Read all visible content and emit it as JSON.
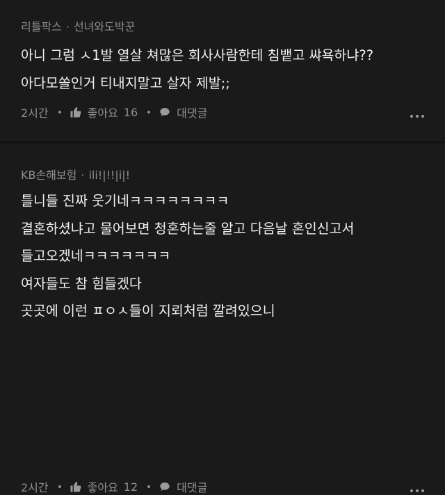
{
  "comments": [
    {
      "author": "리틀팍스",
      "separator": "·",
      "author_tag": "선녀와도박꾼",
      "lines": [
        "아니 그럼 ㅅ1발 열살 쳐많은 회사사람한테 침뱉고 쌰욕하냐??",
        "아다모쏠인거 티내지말고 살자 제발;;"
      ],
      "time": "2시간",
      "like_icon": "thumbs-up-icon",
      "like_label": "좋아요",
      "like_count": "16",
      "reply_icon": "speech-bubble-icon",
      "reply_label": "대댓글",
      "more_icon": "more-dots-icon"
    },
    {
      "author": "KB손해보험",
      "separator": "·",
      "author_tag": "ili!|!!|i|!",
      "lines": [
        "틀니들 진짜 웃기네ㅋㅋㅋㅋㅋㅋㅋㅋ",
        "결혼하셨냐고 물어보면 청혼하는줄 알고 다음날 혼인신고서",
        "들고오겠네ㅋㅋㅋㅋㅋㅋㅋ",
        "여자들도 참 힘들겠다",
        "곳곳에 이런 ㅍㅇㅅ들이 지뢰처럼 깔려있으니"
      ],
      "time": "2시간",
      "like_icon": "thumbs-up-icon",
      "like_label": "좋아요",
      "like_count": "12",
      "reply_icon": "speech-bubble-icon",
      "reply_label": "대댓글",
      "more_icon": "more-dots-icon"
    }
  ],
  "colors": {
    "background": "#1a1a1a",
    "text": "#f0f0f0",
    "meta": "#8f8f8f",
    "divider": "#101010"
  }
}
